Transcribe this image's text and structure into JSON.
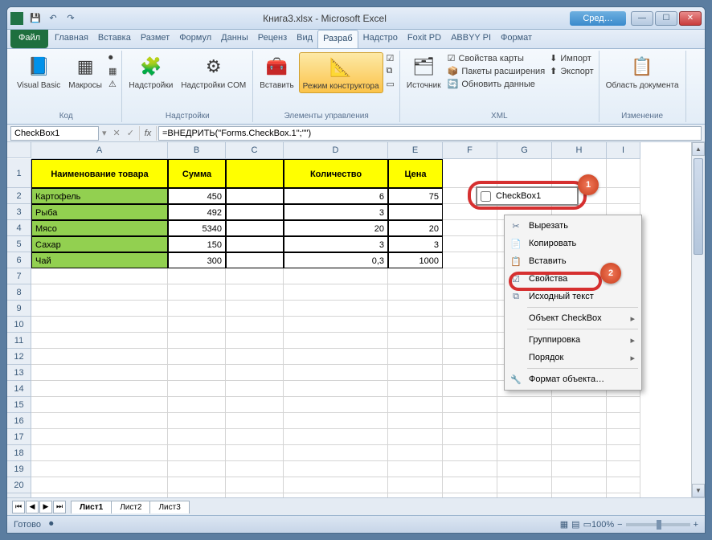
{
  "title": "Книга3.xlsx  -  Microsoft Excel",
  "sred_label": "Сред…",
  "tabs": {
    "file": "Файл",
    "items": [
      "Главная",
      "Вставка",
      "Размет",
      "Формул",
      "Данны",
      "Реценз",
      "Вид",
      "Разраб",
      "Надстро",
      "Foxit PD",
      "ABBYY PI",
      "Формат"
    ],
    "active_index": 7
  },
  "ribbon": {
    "code": {
      "label": "Код",
      "visual_basic": "Visual\nBasic",
      "macros": "Макросы"
    },
    "addins": {
      "label": "Надстройки",
      "addins_btn": "Надстройки",
      "com": "Надстройки\nCOM"
    },
    "controls": {
      "label": "Элементы управления",
      "insert": "Вставить",
      "design": "Режим\nконструктора"
    },
    "xml": {
      "label": "XML",
      "source": "Источник",
      "props": "Свойства карты",
      "ext": "Пакеты расширения",
      "refresh": "Обновить данные",
      "import": "Импорт",
      "export": "Экспорт"
    },
    "modify": {
      "label": "Изменение",
      "panel": "Область\nдокумента"
    }
  },
  "namebox": "CheckBox1",
  "formula": "=ВНЕДРИТЬ(\"Forms.CheckBox.1\";\"\")",
  "columns": [
    "A",
    "B",
    "C",
    "D",
    "E",
    "F",
    "G",
    "H",
    "I"
  ],
  "headers": {
    "name": "Наименование товара",
    "sum": "Сумма",
    "qty": "Количество",
    "price": "Цена"
  },
  "rows": [
    {
      "n": "Картофель",
      "s": "450",
      "q": "6",
      "p": "75"
    },
    {
      "n": "Рыба",
      "s": "492",
      "q": "3",
      "p": ""
    },
    {
      "n": "Мясо",
      "s": "5340",
      "q": "20",
      "p": "20"
    },
    {
      "n": "Сахар",
      "s": "150",
      "q": "3",
      "p": "3"
    },
    {
      "n": "Чай",
      "s": "300",
      "q": "0,3",
      "p": "1000"
    }
  ],
  "checkbox_label": "CheckBox1",
  "context_menu": [
    {
      "icon": "✂",
      "label": "Вырезать"
    },
    {
      "icon": "📄",
      "label": "Копировать"
    },
    {
      "icon": "📋",
      "label": "Вставить"
    },
    {
      "icon": "☑",
      "label": "Свойства"
    },
    {
      "icon": "⧉",
      "label": "Исходный текст"
    },
    {
      "sep": true
    },
    {
      "icon": "",
      "label": "Объект CheckBox",
      "arrow": true
    },
    {
      "sep": true
    },
    {
      "icon": "",
      "label": "Группировка",
      "arrow": true
    },
    {
      "icon": "",
      "label": "Порядок",
      "arrow": true
    },
    {
      "sep": true
    },
    {
      "icon": "🔧",
      "label": "Формат объекта…"
    }
  ],
  "sheets": [
    "Лист1",
    "Лист2",
    "Лист3"
  ],
  "status": "Готово",
  "zoom": "100%"
}
